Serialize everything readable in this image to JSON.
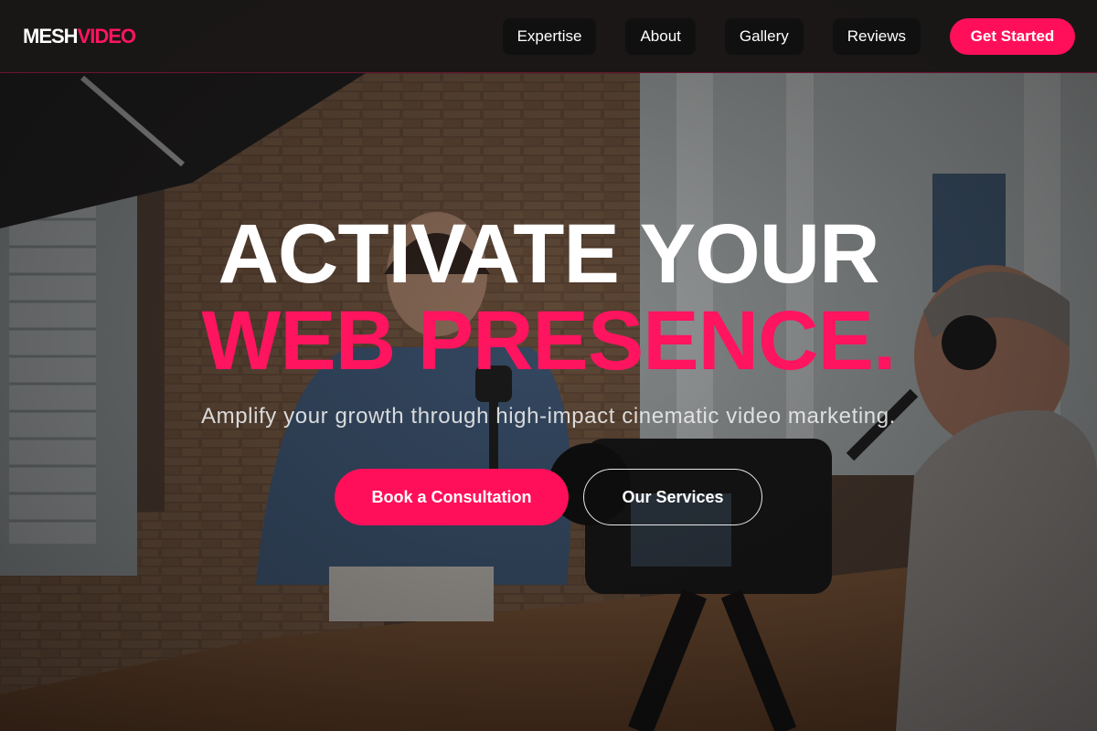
{
  "brand": {
    "logo_part1": "MESH",
    "logo_part2": "VIDEO",
    "accent_color": "#ff1460"
  },
  "nav": {
    "items": [
      {
        "label": "Expertise"
      },
      {
        "label": "About"
      },
      {
        "label": "Gallery"
      },
      {
        "label": "Reviews"
      }
    ],
    "cta_label": "Get Started"
  },
  "hero": {
    "headline_line1": "ACTIVATE YOUR",
    "headline_line2": "WEB PRESENCE.",
    "subtitle": "Amplify your growth through high-impact cinematic video marketing.",
    "primary_button": "Book a Consultation",
    "secondary_button": "Our Services",
    "background_image": "podcast-studio-photo"
  }
}
